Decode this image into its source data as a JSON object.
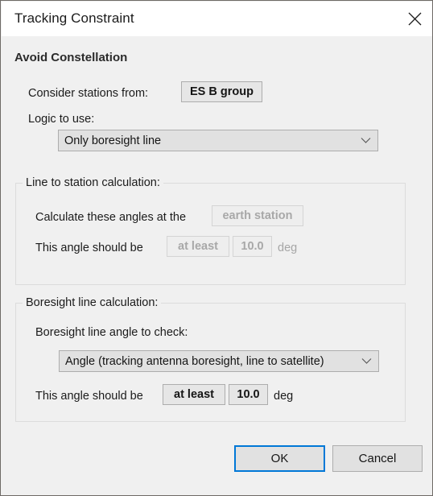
{
  "window": {
    "title": "Tracking Constraint",
    "close_icon": "close-icon"
  },
  "section": {
    "heading": "Avoid Constellation"
  },
  "stations": {
    "label": "Consider stations from:",
    "value": "ES B group"
  },
  "logic": {
    "label": "Logic to use:",
    "value": "Only boresight line",
    "chevron_icon": "chevron-down-icon"
  },
  "line_to_station": {
    "title": "Line to station calculation:",
    "calc_at_label": "Calculate these angles at the",
    "calc_at_value": "earth station",
    "angle_label": "This angle should be",
    "comparison": "at least",
    "angle_value": "10.0",
    "units": "deg"
  },
  "boresight": {
    "title": "Boresight line calculation:",
    "angle_to_check_label": "Boresight line angle to check:",
    "angle_to_check_value": "Angle (tracking antenna boresight, line to satellite)",
    "chevron_icon": "chevron-down-icon",
    "angle_label": "This angle should be",
    "comparison": "at least",
    "angle_value": "10.0",
    "units": "deg"
  },
  "footer": {
    "ok_label": "OK",
    "cancel_label": "Cancel"
  },
  "colors": {
    "accent": "#0078d7",
    "window_bg": "#f0f0f0",
    "titlebar_bg": "#ffffff",
    "disabled_text": "#a8a8a8"
  }
}
